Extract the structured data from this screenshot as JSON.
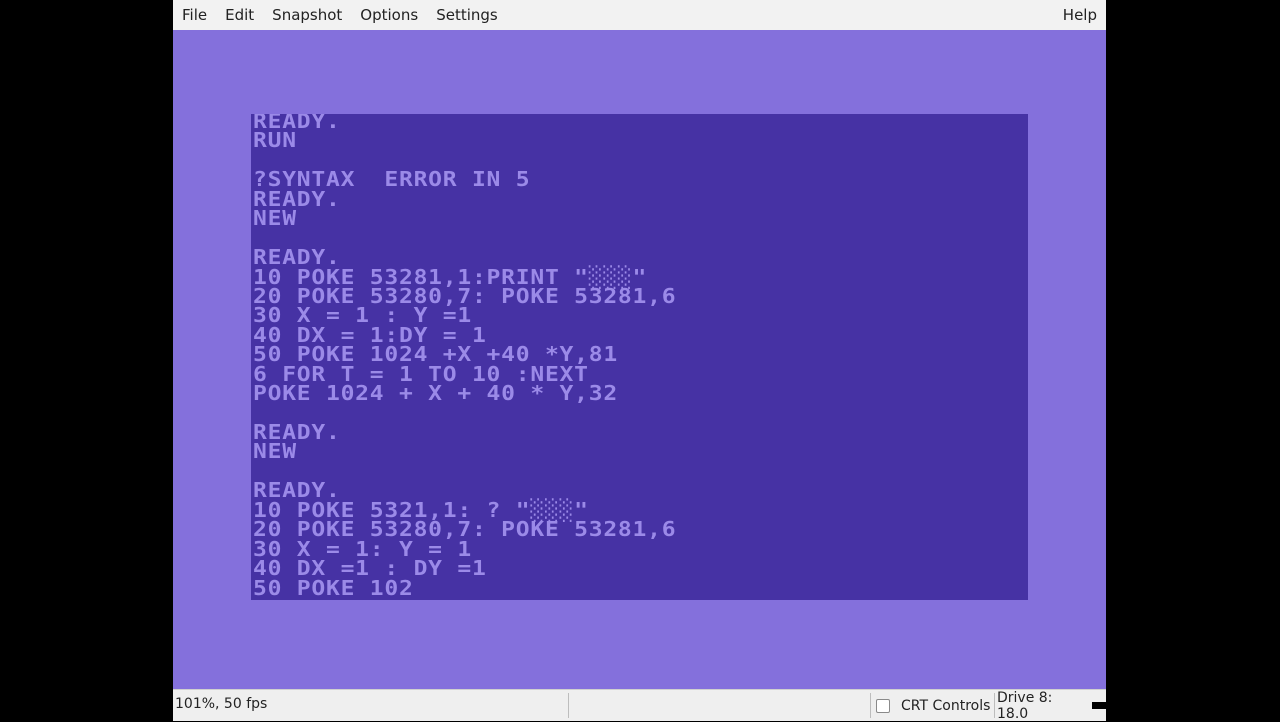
{
  "menubar": {
    "items": [
      "File",
      "Edit",
      "Snapshot",
      "Options",
      "Settings"
    ],
    "help": "Help"
  },
  "screen_lines": [
    "READY.",
    "RUN",
    "",
    "?SYNTAX  ERROR IN 5",
    "READY.",
    "NEW",
    "",
    "READY.",
    "10 POKE 53281,1:PRINT \"░░░\"",
    "20 POKE 53280,7: POKE 53281,6",
    "30 X = 1 : Y =1",
    "40 DX = 1:DY = 1",
    "50 POKE 1024 +X +40 *Y,81",
    "6 FOR T = 1 TO 10 :NEXT",
    "POKE 1024 + X + 40 * Y,32",
    "",
    "READY.",
    "NEW",
    "",
    "READY.",
    "10 POKE 5321,1: ? \"░░░\"",
    "20 POKE 53280,7: POKE 53281,6",
    "30 X = 1: Y = 1",
    "40 DX =1 : DY =1",
    "50 POKE 102"
  ],
  "statusbar": {
    "zoom_fps": "101%, 50 fps",
    "crt_label": "CRT Controls",
    "drive": "Drive 8: 18.0"
  },
  "colors": {
    "border": "#8470dc",
    "background": "#4632a4",
    "text": "#9b8ae8"
  }
}
